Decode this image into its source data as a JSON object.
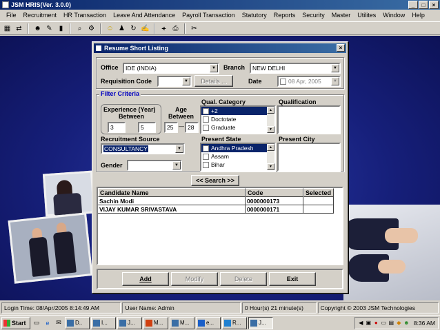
{
  "app": {
    "title": "JSM HRIS(Ver. 3.0.0)"
  },
  "window_buttons": [
    "_",
    "□",
    "×"
  ],
  "menu": [
    "File",
    "Recruitment",
    "HR Transaction",
    "Leave And Attendance",
    "Payroll Transaction",
    "Statutory",
    "Reports",
    "Security",
    "Master",
    "Utilites",
    "Window",
    "Help"
  ],
  "dialog": {
    "title": "Resume Short Listing",
    "close": "×",
    "office": {
      "label": "Office",
      "value": "IDE (INDIA)"
    },
    "branch": {
      "label": "Branch",
      "value": "NEW DELHI"
    },
    "requisition": {
      "label": "Requisition Code",
      "value": ""
    },
    "details_button": "Details ...",
    "date": {
      "label": "Date",
      "value": "08 Apr, 2005"
    },
    "filter": {
      "title": "Filter Criteria",
      "experience": {
        "label1": "Experience (Year)",
        "label2": "Between",
        "min": "3",
        "max": "5"
      },
      "age": {
        "label1": "Age",
        "label2": "Between",
        "min": "25",
        "separator": "—",
        "max": "28"
      },
      "qual_category": {
        "label": "Qual. Category",
        "items": [
          "+2",
          "Doctotate",
          "Graduate"
        ],
        "selected_index": 0
      },
      "qualification": {
        "label": "Qualification"
      },
      "recruitment_source": {
        "label": "Recruitment Source",
        "value": "CONSULTANCY"
      },
      "present_state": {
        "label": "Present State",
        "items": [
          "Andhra Pradesh",
          "Assam",
          "Bihar"
        ],
        "selected_index": 0
      },
      "present_city": {
        "label": "Present City"
      },
      "gender": {
        "label": "Gender",
        "value": ""
      }
    },
    "search_button": "<< Search >>",
    "table": {
      "columns": [
        "Candidate Name",
        "Code",
        "Selected"
      ],
      "rows": [
        {
          "name": "Sachin Modi",
          "code": "0000000173",
          "selected": ""
        },
        {
          "name": "VIJAY KUMAR SRIVASTAVA",
          "code": "0000000171",
          "selected": ""
        }
      ]
    },
    "buttons": {
      "add": "Add",
      "modify": "Modify",
      "delete": "Delete",
      "exit": "Exit"
    }
  },
  "status": {
    "login": "Login Time: 08/Apr/2005 8:14:49 AM",
    "user": "User Name: Admin",
    "elapsed": "0 Hour(s) 21 minute(s)",
    "copyright": "Copyright © 2003 JSM Technologies"
  },
  "taskbar": {
    "start": "Start",
    "tasks": [
      "D..",
      "I...",
      "J...",
      "M...",
      "M...",
      "e...",
      "R...",
      "J..."
    ],
    "active_task_index": 7,
    "clock": "8:36 AM"
  },
  "colors": {
    "title_gradient_start": "#0a246a",
    "title_gradient_end": "#3a6ea5",
    "desktop": "#161f7a",
    "filter_label": "#0000c0"
  }
}
